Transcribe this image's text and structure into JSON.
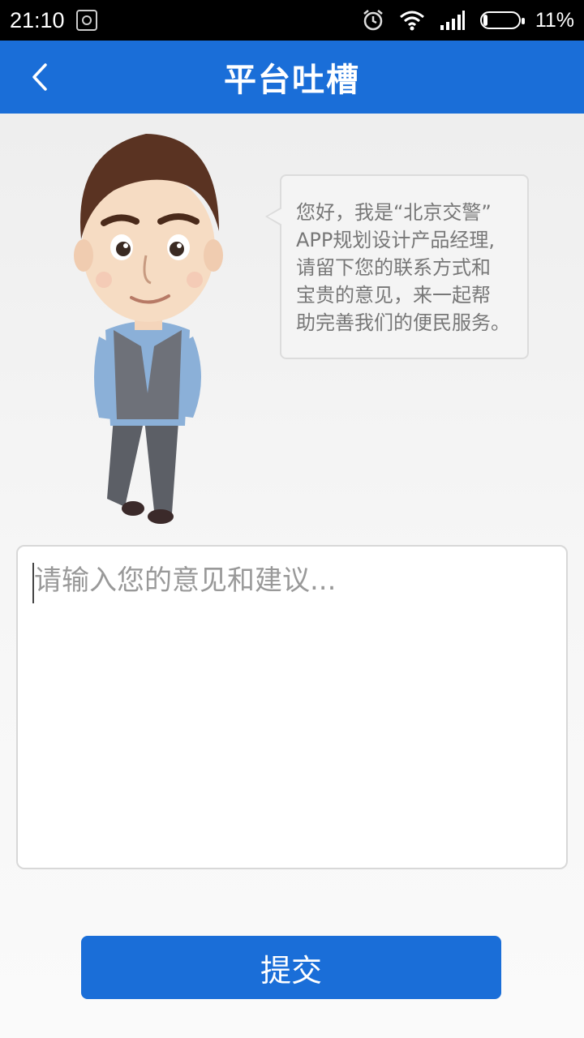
{
  "status_bar": {
    "time": "21:10",
    "battery_percent_text": "11%",
    "battery_level": 0.11,
    "icons": [
      "notification-icon",
      "alarm-icon",
      "wifi-icon",
      "signal-icon",
      "battery-icon"
    ]
  },
  "header": {
    "title": "平台吐槽",
    "back_icon": "chevron-left-icon",
    "background_color": "#1a6ed8"
  },
  "bubble": {
    "lines": [
      "您好，我是“北京交警”",
      "APP规划设计产品经理,",
      "请留下您的联系方式和",
      "宝贵的意见，来一起帮",
      "助完善我们的便民服务。"
    ]
  },
  "feedback": {
    "placeholder": "请输入您的意见和建议...",
    "value": ""
  },
  "submit": {
    "label": "提交"
  },
  "colors": {
    "accent": "#1a6ed8",
    "bubble_text": "#777777"
  }
}
